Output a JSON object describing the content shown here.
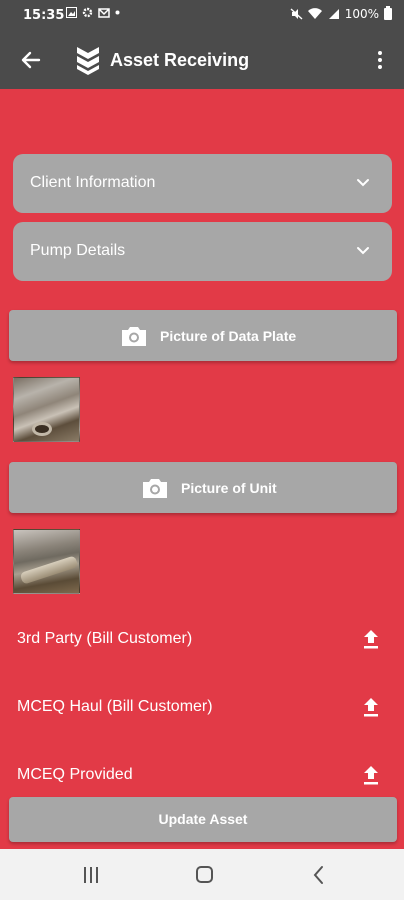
{
  "status_bar": {
    "time": "15:35",
    "battery": "100%"
  },
  "app_bar": {
    "title": "Asset Receiving"
  },
  "sections": [
    {
      "label": "Client Information"
    },
    {
      "label": "Pump Details"
    }
  ],
  "photo_buttons": [
    {
      "label": "Picture of Data Plate"
    },
    {
      "label": "Picture of Unit"
    }
  ],
  "uploads": [
    {
      "label": "3rd Party (Bill Customer)"
    },
    {
      "label": "MCEQ Haul (Bill Customer)"
    },
    {
      "label": "MCEQ Provided"
    }
  ],
  "footer": {
    "update_label": "Update Asset"
  },
  "colors": {
    "background": "#e23a47",
    "app_bar": "#4b4b4b",
    "button": "#a7a7a7"
  }
}
